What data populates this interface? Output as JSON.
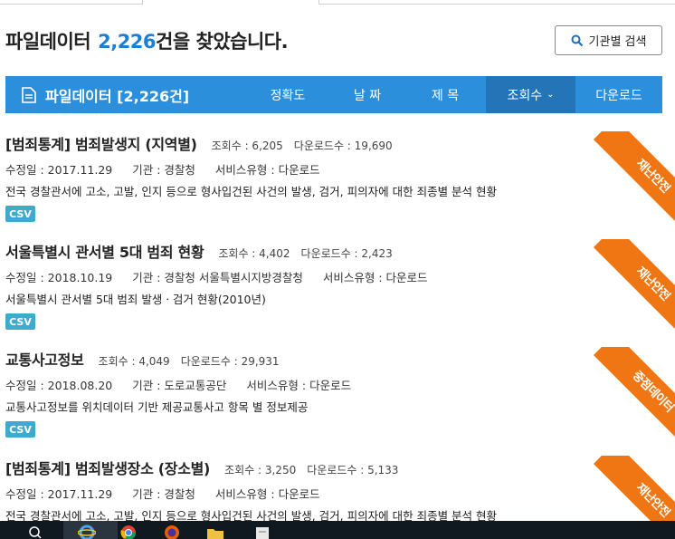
{
  "header": {
    "prefix": "파일데이터",
    "count": "2,226",
    "suffix": "건을 찾았습니다.",
    "agency_search": "기관별 검색"
  },
  "bar": {
    "title": "파일데이터 [2,226건]",
    "sort": [
      "정확도",
      "날   짜",
      "제   목",
      "조회수",
      "다운로드"
    ],
    "active_sort": "조회수"
  },
  "items": [
    {
      "title": "[범죄통계] 범죄발생지 (지역별)",
      "views": "조회수 : 6,205",
      "downloads": "다운로드수 : 19,690",
      "modified": "수정일 : 2017.11.29",
      "agency": "기관 : 경찰청",
      "service": "서비스유형 : 다운로드",
      "desc": "전국 경찰관서에 고소, 고발, 인지 등으로 형사입건된 사건의 발생, 검거, 피의자에 대한 죄종별 분석 현황",
      "format": "CSV",
      "ribbon": "재난안전"
    },
    {
      "title": "서울특별시 관서별 5대 범죄 현황",
      "views": "조회수 : 4,402",
      "downloads": "다운로드수 : 2,423",
      "modified": "수정일 : 2018.10.19",
      "agency": "기관 : 경찰청 서울특별시지방경찰청",
      "service": "서비스유형 : 다운로드",
      "desc": "서울특별시 관서별 5대 범죄 발생ㆍ검거 현황(2010년)",
      "format": "CSV",
      "ribbon": "재난안전"
    },
    {
      "title": "교통사고정보",
      "views": "조회수 : 4,049",
      "downloads": "다운로드수 : 29,931",
      "modified": "수정일 : 2018.08.20",
      "agency": "기관 : 도로교통공단",
      "service": "서비스유형 : 다운로드",
      "desc": "교통사고정보를 위치데이터 기반 제공교통사고 항목 별 정보제공",
      "format": "CSV",
      "ribbon": "중점데이터"
    },
    {
      "title": "[범죄통계] 범죄발생장소 (장소별)",
      "views": "조회수 : 3,250",
      "downloads": "다운로드수 : 5,133",
      "modified": "수정일 : 2017.11.29",
      "agency": "기관 : 경찰청",
      "service": "서비스유형 : 다운로드",
      "desc": "전국 경찰관서에 고소, 고발, 인지 등으로 형사입건된 사건의 발생, 검거, 피의자에 대한 죄종별 분석 현황",
      "format": "",
      "ribbon": "재난안전"
    }
  ],
  "colors": {
    "accent": "#2b8fdb",
    "active_sort": "#2375b8",
    "count": "#1c7fd6",
    "ribbon": "#f07613",
    "csv": "#3eaacd"
  },
  "taskbar": {
    "icons": [
      "search-icon",
      "ie-icon",
      "chrome-icon",
      "firefox-icon",
      "folder-icon",
      "notepad-icon"
    ]
  }
}
